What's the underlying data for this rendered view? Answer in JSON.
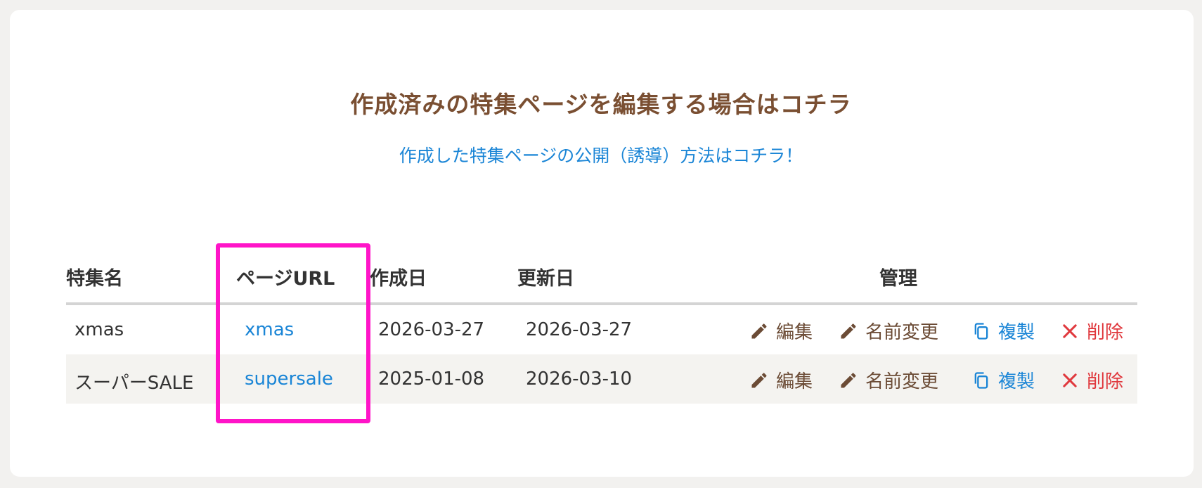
{
  "header": {
    "title": "作成済みの特集ページを編集する場合はコチラ",
    "guide_link": "作成した特集ページの公開（誘導）方法はコチラ！"
  },
  "table": {
    "columns": {
      "name": "特集名",
      "url": "ページURL",
      "created": "作成日",
      "updated": "更新日",
      "manage": "管理"
    },
    "rows": [
      {
        "name": "xmas",
        "url": "xmas",
        "created": "2026-03-27",
        "updated": "2026-03-27"
      },
      {
        "name": "スーパーSALE",
        "url": "supersale",
        "created": "2025-01-08",
        "updated": "2026-03-10"
      }
    ],
    "actions": {
      "edit": "編集",
      "rename": "名前変更",
      "copy": "複製",
      "delete": "削除"
    }
  },
  "icons": {
    "edit": "pencil-icon",
    "rename": "pencil-icon",
    "copy": "copy-icon",
    "delete": "close-icon"
  },
  "colors": {
    "title": "#7a4f32",
    "link": "#1a85d6",
    "action_edit": "#6b4b35",
    "action_delete": "#e0393e",
    "highlight_box": "#ff14c8",
    "alt_row": "#f4f3f0"
  }
}
